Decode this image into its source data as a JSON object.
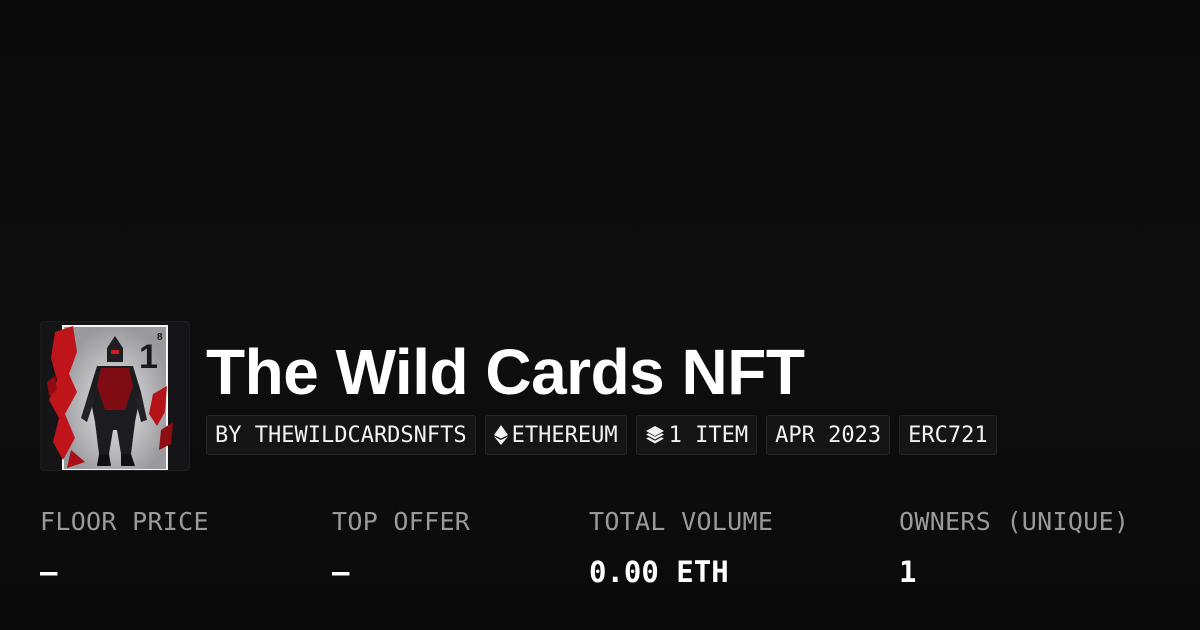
{
  "collection": {
    "title": "The Wild Cards NFT",
    "thumbnail_icon": "wild-card-knight-artwork"
  },
  "pills": {
    "creator": "BY THEWILDCARDSNFTS",
    "chain": "ETHEREUM",
    "chain_icon": "ethereum-icon",
    "items": "1 ITEM",
    "items_icon": "layers-icon",
    "date": "APR 2023",
    "standard": "ERC721"
  },
  "stats": {
    "floor_price_label": "FLOOR PRICE",
    "floor_price_value": "–",
    "top_offer_label": "TOP OFFER",
    "top_offer_value": "–",
    "total_volume_label": "TOTAL VOLUME",
    "total_volume_value": "0.00 ETH",
    "owners_label": "OWNERS (UNIQUE)",
    "owners_value": "1"
  },
  "colors": {
    "background": "#0b0b0b",
    "pill_bg": "#151515",
    "label_gray": "#9a9a9a",
    "accent_red": "#c0141b"
  }
}
